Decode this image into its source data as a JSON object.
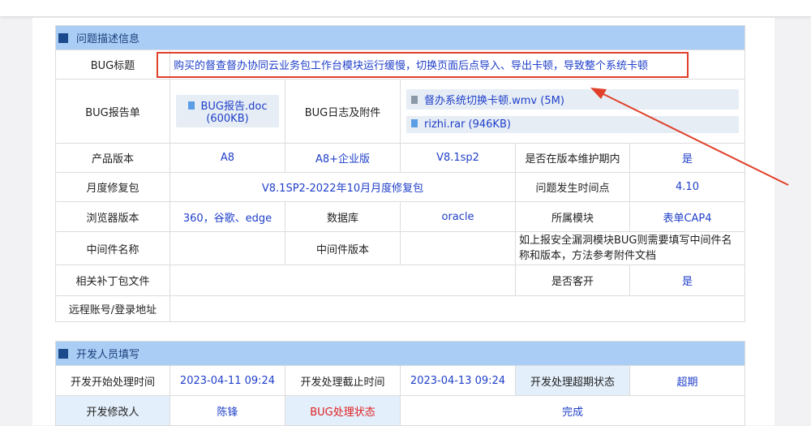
{
  "section1": {
    "title": "问题描述信息",
    "bug_title_label": "BUG标题",
    "bug_title": "购买的督查督办协同云业务包工作台模块运行缓慢，切换页面后点导入、导出卡顿，导致整个系统卡顿",
    "report_label": "BUG报告单",
    "report_file": "BUG报告.doc (600KB)",
    "log_label": "BUG日志及附件",
    "attachments": [
      "督办系统切换卡顿.wmv (5M)",
      "rizhi.rar (946KB)"
    ],
    "product_version_label": "产品版本",
    "product": "A8",
    "edition": "A8+企业版",
    "version": "V8.1sp2",
    "maintenance_label": "是否在版本维护期内",
    "maintenance": "是",
    "monthly_patch_label": "月度修复包",
    "monthly_patch": "V8.1SP2-2022年10月月度修复包",
    "occur_time_label": "问题发生时间点",
    "occur_time": "4.10",
    "browser_label": "浏览器版本",
    "browser": "360，谷歌、edge",
    "db_label": "数据库",
    "db": "oracle",
    "module_label": "所属模块",
    "module": "表单CAP4",
    "middleware_label": "中间件名称",
    "middleware_version_label": "中间件版本",
    "middleware_note": "如上报安全漏洞模块BUG则需要填写中间件名称和版本，方法参考附件文档",
    "patch_files_label": "相关补丁包文件",
    "customer_label": "是否客开",
    "customer": "是",
    "remote_label": "远程账号/登录地址"
  },
  "section2": {
    "title": "开发人员填写",
    "start_label": "开发开始处理时间",
    "start": "2023-04-11 09:24",
    "deadline_label": "开发处理截止时间",
    "deadline": "2023-04-13 09:24",
    "overdue_label": "开发处理超期状态",
    "overdue": "超期",
    "dev_label": "开发修改人",
    "dev": "陈锋",
    "status_label": "BUG处理状态",
    "status": "完成"
  },
  "colors": {
    "header": "#a9cdf5",
    "link": "#1f3fc9",
    "annotation": "#e0402a"
  }
}
